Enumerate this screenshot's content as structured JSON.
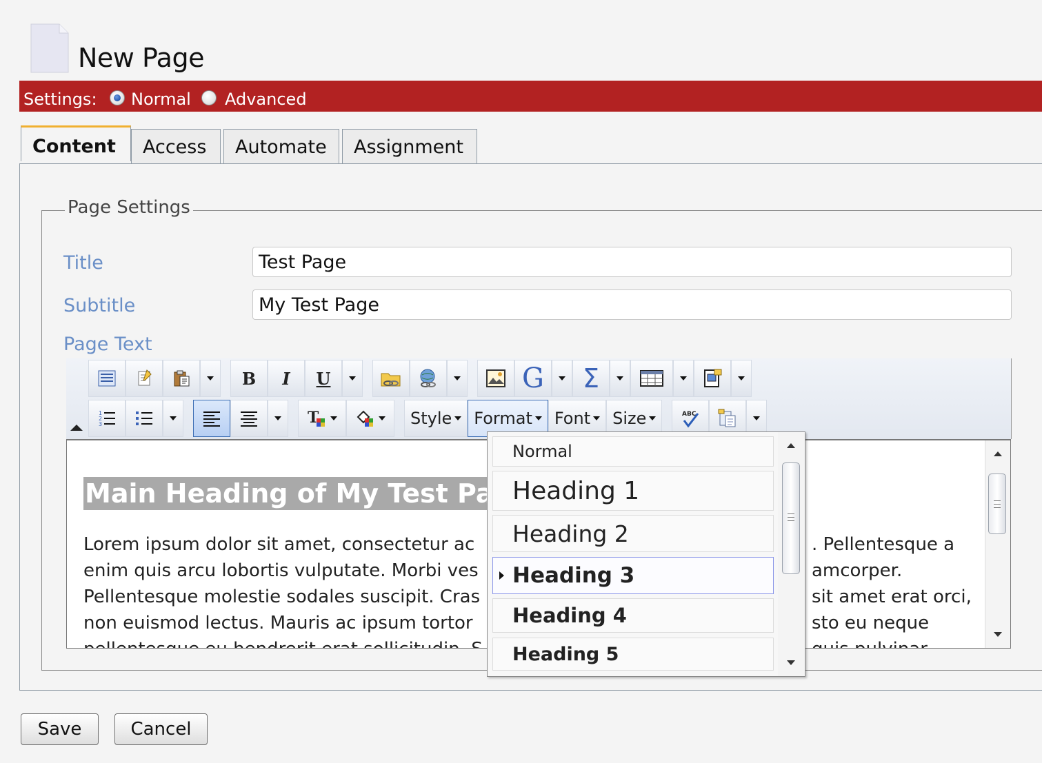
{
  "header": {
    "title": "New Page"
  },
  "settings": {
    "label": "Settings:",
    "options": [
      {
        "label": "Normal",
        "selected": true
      },
      {
        "label": "Advanced",
        "selected": false
      }
    ]
  },
  "tabs": [
    {
      "label": "Content",
      "active": true
    },
    {
      "label": "Access",
      "active": false
    },
    {
      "label": "Automate",
      "active": false
    },
    {
      "label": "Assignment",
      "active": false
    }
  ],
  "page_settings": {
    "legend": "Page Settings",
    "title_label": "Title",
    "title_value": "Test Page",
    "subtitle_label": "Subtitle",
    "subtitle_value": "My Test Page",
    "page_text_label": "Page Text"
  },
  "toolbar": {
    "style_label": "Style",
    "format_label": "Format",
    "font_label": "Font",
    "size_label": "Size",
    "bold_glyph": "B",
    "italic_glyph": "I",
    "underline_glyph": "U"
  },
  "editor": {
    "heading": "Main Heading of My Test Page",
    "lines_left": [
      "Lorem ipsum dolor sit amet, consectetur ac",
      "enim quis arcu lobortis vulputate. Morbi ves",
      "Pellentesque molestie sodales suscipit. Cras",
      "non euismod lectus. Mauris ac ipsum tortor",
      "pellentesque eu hendrerit erat sollicitudin. S"
    ],
    "lines_right": [
      ". Pellentesque a",
      "amcorper.",
      "sit amet erat orci,",
      "sto eu neque",
      "quis pulvinar"
    ]
  },
  "format_dropdown": {
    "items": [
      {
        "label": "Normal",
        "selected": false
      },
      {
        "label": "Heading 1",
        "selected": false
      },
      {
        "label": "Heading 2",
        "selected": false
      },
      {
        "label": "Heading 3",
        "selected": true
      },
      {
        "label": "Heading 4",
        "selected": false
      },
      {
        "label": "Heading 5",
        "selected": false
      }
    ]
  },
  "actions": {
    "save_label": "Save",
    "cancel_label": "Cancel"
  },
  "colors": {
    "settings_bar": "#b22222",
    "label_blue": "#6a8fc7",
    "tab_accent": "#f0b030"
  }
}
